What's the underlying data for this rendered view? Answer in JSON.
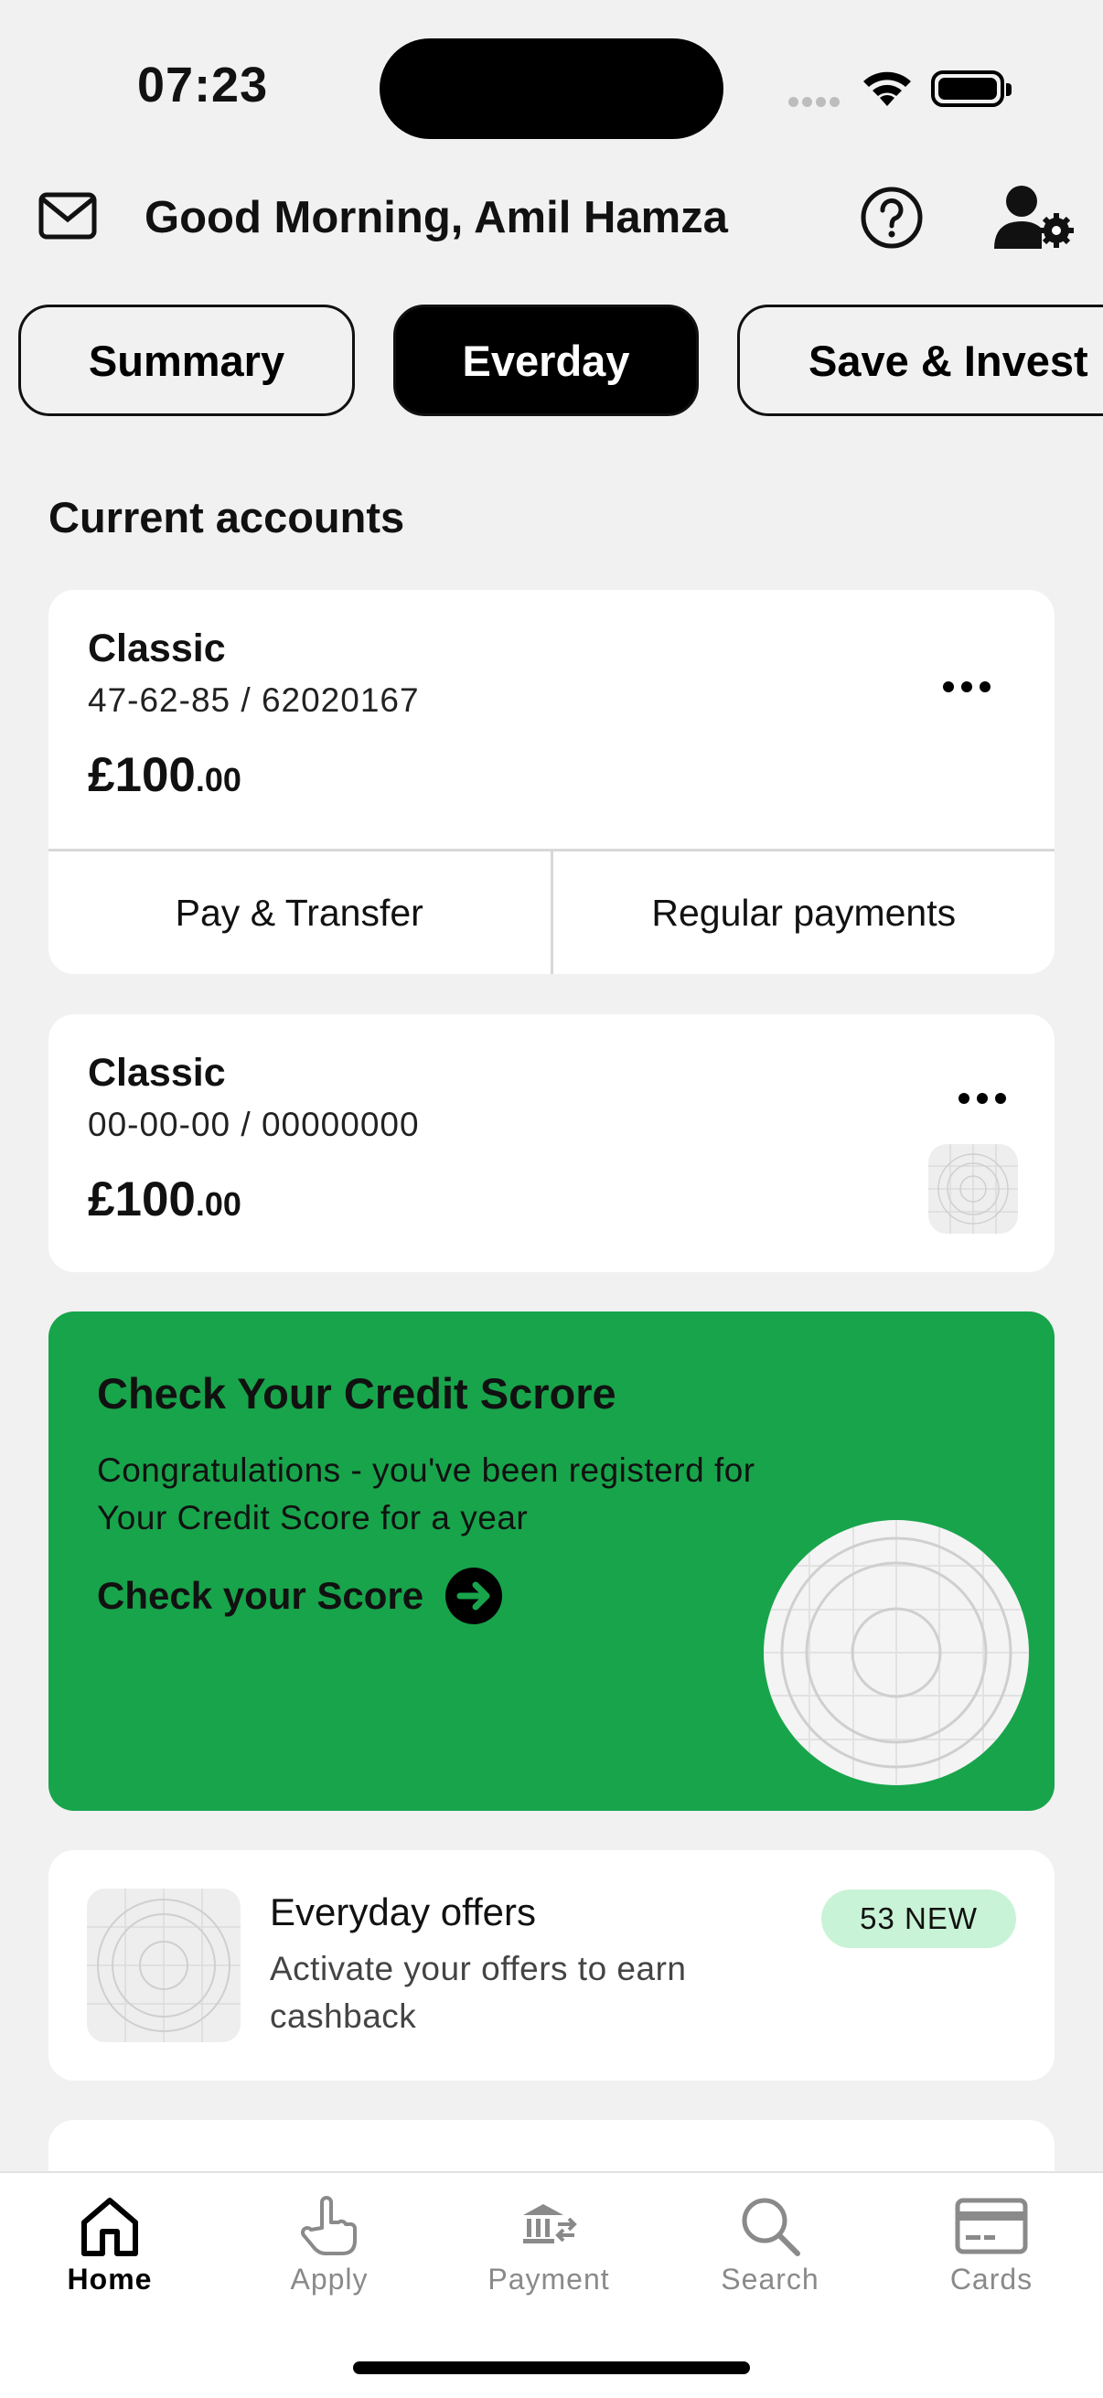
{
  "status_bar": {
    "time": "07:23"
  },
  "header": {
    "greeting": "Good Morning, Amil Hamza"
  },
  "tabs": [
    {
      "label": "Summary",
      "active": false
    },
    {
      "label": "Everday",
      "active": true
    },
    {
      "label": "Save & Invest",
      "active": false
    }
  ],
  "section": {
    "title": "Current accounts"
  },
  "accounts": [
    {
      "name": "Classic",
      "number": "47-62-85 / 62020167",
      "balance_main": "£100",
      "balance_dec": ".00",
      "actions": [
        "Pay & Transfer",
        "Regular payments"
      ]
    },
    {
      "name": "Classic",
      "number": "00-00-00 / 00000000",
      "balance_main": "£100",
      "balance_dec": ".00"
    }
  ],
  "promo": {
    "title": "Check Your Credit Scrore",
    "text": "Congratulations - you've been registerd for Your Credit Score for a year",
    "link": "Check your Score",
    "bg_color": "#18a44b"
  },
  "offers": {
    "title": "Everyday offers",
    "text": "Activate your offers to earn cashback",
    "badge": "53 NEW",
    "badge_color": "#c9f3d6"
  },
  "nav": [
    {
      "label": "Home",
      "icon": "home-icon",
      "active": true
    },
    {
      "label": "Apply",
      "icon": "hand-pointer-icon",
      "active": false
    },
    {
      "label": "Payment",
      "icon": "bank-transfer-icon",
      "active": false
    },
    {
      "label": "Search",
      "icon": "search-icon",
      "active": false
    },
    {
      "label": "Cards",
      "icon": "card-icon",
      "active": false
    }
  ]
}
